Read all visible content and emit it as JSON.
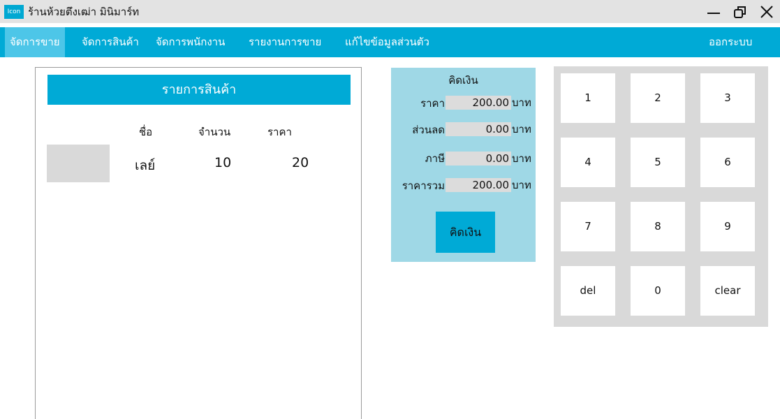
{
  "window": {
    "icon_label": "Icon",
    "title": "ร้านห้วยตึงเฒ่า มินิมาร์ท",
    "min_glyph": "—",
    "max_glyph": "⧉",
    "close_glyph": "✕"
  },
  "nav": {
    "items": [
      {
        "label": "จัดการขาย",
        "active": true
      },
      {
        "label": "จัดการสินค้า"
      },
      {
        "label": "จัดการพนักงาน"
      },
      {
        "label": "รายงานการขาย"
      },
      {
        "label": "แก้ไขข้อมูลส่วนตัว"
      }
    ],
    "logout": "ออกระบบ"
  },
  "product_list": {
    "header": "รายการสินค้า",
    "columns": [
      "ชื่อ",
      "จำนวน",
      "ราคา"
    ],
    "rows": [
      {
        "name": "เลย์",
        "quantity": "10",
        "price": "20"
      }
    ]
  },
  "payment": {
    "title": "คิดเงิน",
    "fields": [
      {
        "label": "ราคา",
        "value": "200.00",
        "unit": "บาท"
      },
      {
        "label": "ส่วนลด",
        "value": "0.00",
        "unit": "บาท"
      },
      {
        "label": "ภาษี",
        "value": "0.00",
        "unit": "บาท"
      },
      {
        "label": "ราคารวม",
        "value": "200.00",
        "unit": "บาท"
      }
    ],
    "button": "คิดเงิน"
  },
  "keypad": {
    "keys": [
      "1",
      "2",
      "3",
      "4",
      "5",
      "6",
      "7",
      "8",
      "9",
      "del",
      "0",
      "clear"
    ]
  }
}
